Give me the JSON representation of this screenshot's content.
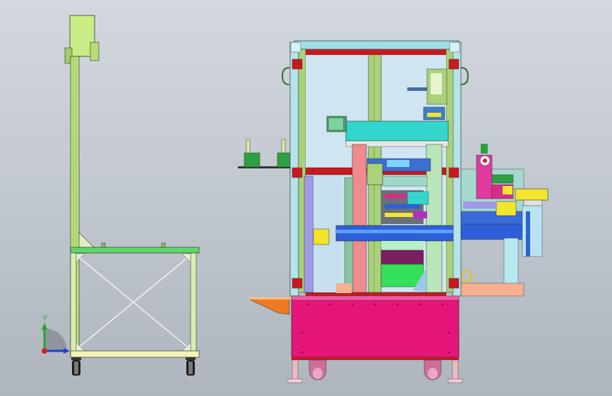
{
  "viewport": {
    "background_top": "#d3d8de",
    "background_bottom": "#aeb5bd"
  },
  "triad": {
    "y_axis_label": "Y",
    "x_axis_color": "#1f3fd6",
    "y_axis_color": "#1fa82c",
    "z_axis_color": "#d61f1f"
  },
  "palette": {
    "frame_red": "#c41a20",
    "frame_green": "#a9d27a",
    "magenta_base": "#e5157a",
    "cyan_block": "#33d6cc",
    "yellow_green": "#c9e87a",
    "blue_rail": "#2d5fd8",
    "yellow_part": "#f2e52b",
    "salmon": "#f2a48e",
    "lavender": "#9e9ae3",
    "light_cyan": "#b6e8ef"
  }
}
